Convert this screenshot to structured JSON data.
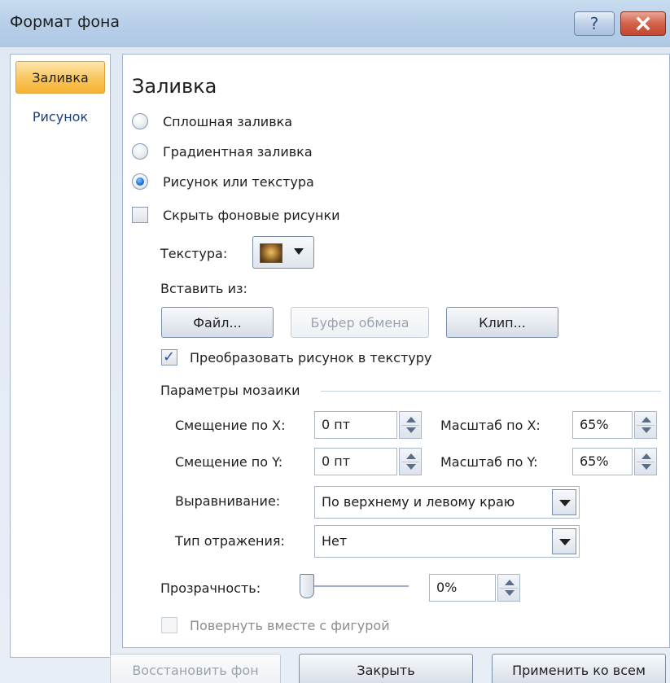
{
  "window": {
    "title": "Формат фона",
    "help_label": "?"
  },
  "nav": {
    "items": [
      {
        "label": "Заливка",
        "selected": true
      },
      {
        "label": "Рисунок",
        "selected": false
      }
    ]
  },
  "panel": {
    "heading": "Заливка",
    "fill_options": [
      {
        "label": "Сплошная заливка",
        "checked": false
      },
      {
        "label": "Градиентная заливка",
        "checked": false
      },
      {
        "label": "Рисунок или текстура",
        "checked": true
      }
    ],
    "hide_background": {
      "label": "Скрыть фоновые рисунки",
      "checked": false
    },
    "texture_label": "Текстура:",
    "insert_from_label": "Вставить из:",
    "buttons": {
      "file": "Файл...",
      "clipboard": "Буфер обмена",
      "clip": "Клип..."
    },
    "convert_to_texture": {
      "label": "Преобразовать рисунок в текстуру",
      "checked": true
    },
    "tiling": {
      "group_label": "Параметры мозаики",
      "offset_x_label": "Смещение по X:",
      "offset_x_value": "0 пт",
      "scale_x_label": "Масштаб по X:",
      "scale_x_value": "65%",
      "offset_y_label": "Смещение по Y:",
      "offset_y_value": "0 пт",
      "scale_y_label": "Масштаб по Y:",
      "scale_y_value": "65%",
      "alignment_label": "Выравнивание:",
      "alignment_value": "По верхнему и левому краю",
      "mirror_label": "Тип отражения:",
      "mirror_value": "Нет"
    },
    "transparency": {
      "label": "Прозрачность:",
      "value": "0%",
      "level": 0
    },
    "rotate_with_shape": {
      "label": "Повернуть вместе с фигурой",
      "checked": false,
      "disabled": true
    }
  },
  "footer": {
    "reset": "Восстановить фон",
    "close": "Закрыть",
    "apply_all": "Применить ко всем"
  },
  "colors": {
    "selected_nav": "#f9c55b",
    "close_button": "#d4614a",
    "accent_blue": "#1d6fd1"
  }
}
